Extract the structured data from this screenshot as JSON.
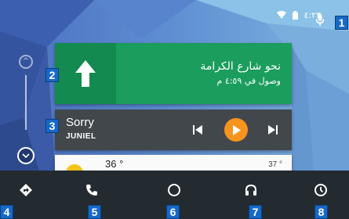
{
  "status": {
    "time": "٤:٢٣"
  },
  "navigation": {
    "street": "نحو شارع الكرامة",
    "eta": "وصول في ٤:٥٩ م"
  },
  "media": {
    "title": "Sorry",
    "artist": "JUNIEL",
    "accent_color": "#f7941d"
  },
  "weather": {
    "temperature": "36 °",
    "temperature_secondary": "37 °"
  },
  "bottom_nav": [
    {
      "icon": "navigation-icon"
    },
    {
      "icon": "phone-icon"
    },
    {
      "icon": "home-circle-icon"
    },
    {
      "icon": "headphones-icon"
    },
    {
      "icon": "recents-icon"
    }
  ],
  "annotations": [
    "1",
    "2",
    "3",
    "4",
    "5",
    "6",
    "7",
    "8"
  ],
  "colors": {
    "nav_card_primary": "#1a9d5d",
    "nav_card_dark": "#138a4f",
    "media_card": "#42474c",
    "navbar": "#232b31",
    "annotation_marker": "#1669c8"
  }
}
